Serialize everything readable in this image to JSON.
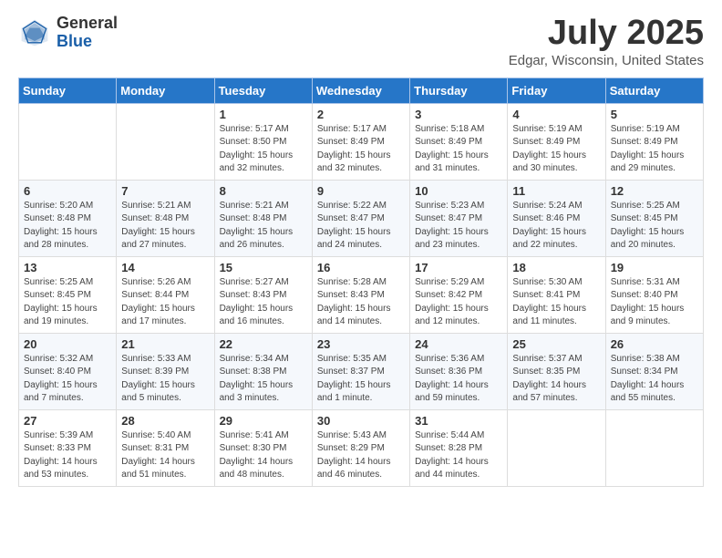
{
  "header": {
    "logo_general": "General",
    "logo_blue": "Blue",
    "month_title": "July 2025",
    "location": "Edgar, Wisconsin, United States"
  },
  "weekdays": [
    "Sunday",
    "Monday",
    "Tuesday",
    "Wednesday",
    "Thursday",
    "Friday",
    "Saturday"
  ],
  "weeks": [
    [
      {
        "day": "",
        "info": ""
      },
      {
        "day": "",
        "info": ""
      },
      {
        "day": "1",
        "info": "Sunrise: 5:17 AM\nSunset: 8:50 PM\nDaylight: 15 hours and 32 minutes."
      },
      {
        "day": "2",
        "info": "Sunrise: 5:17 AM\nSunset: 8:49 PM\nDaylight: 15 hours and 32 minutes."
      },
      {
        "day": "3",
        "info": "Sunrise: 5:18 AM\nSunset: 8:49 PM\nDaylight: 15 hours and 31 minutes."
      },
      {
        "day": "4",
        "info": "Sunrise: 5:19 AM\nSunset: 8:49 PM\nDaylight: 15 hours and 30 minutes."
      },
      {
        "day": "5",
        "info": "Sunrise: 5:19 AM\nSunset: 8:49 PM\nDaylight: 15 hours and 29 minutes."
      }
    ],
    [
      {
        "day": "6",
        "info": "Sunrise: 5:20 AM\nSunset: 8:48 PM\nDaylight: 15 hours and 28 minutes."
      },
      {
        "day": "7",
        "info": "Sunrise: 5:21 AM\nSunset: 8:48 PM\nDaylight: 15 hours and 27 minutes."
      },
      {
        "day": "8",
        "info": "Sunrise: 5:21 AM\nSunset: 8:48 PM\nDaylight: 15 hours and 26 minutes."
      },
      {
        "day": "9",
        "info": "Sunrise: 5:22 AM\nSunset: 8:47 PM\nDaylight: 15 hours and 24 minutes."
      },
      {
        "day": "10",
        "info": "Sunrise: 5:23 AM\nSunset: 8:47 PM\nDaylight: 15 hours and 23 minutes."
      },
      {
        "day": "11",
        "info": "Sunrise: 5:24 AM\nSunset: 8:46 PM\nDaylight: 15 hours and 22 minutes."
      },
      {
        "day": "12",
        "info": "Sunrise: 5:25 AM\nSunset: 8:45 PM\nDaylight: 15 hours and 20 minutes."
      }
    ],
    [
      {
        "day": "13",
        "info": "Sunrise: 5:25 AM\nSunset: 8:45 PM\nDaylight: 15 hours and 19 minutes."
      },
      {
        "day": "14",
        "info": "Sunrise: 5:26 AM\nSunset: 8:44 PM\nDaylight: 15 hours and 17 minutes."
      },
      {
        "day": "15",
        "info": "Sunrise: 5:27 AM\nSunset: 8:43 PM\nDaylight: 15 hours and 16 minutes."
      },
      {
        "day": "16",
        "info": "Sunrise: 5:28 AM\nSunset: 8:43 PM\nDaylight: 15 hours and 14 minutes."
      },
      {
        "day": "17",
        "info": "Sunrise: 5:29 AM\nSunset: 8:42 PM\nDaylight: 15 hours and 12 minutes."
      },
      {
        "day": "18",
        "info": "Sunrise: 5:30 AM\nSunset: 8:41 PM\nDaylight: 15 hours and 11 minutes."
      },
      {
        "day": "19",
        "info": "Sunrise: 5:31 AM\nSunset: 8:40 PM\nDaylight: 15 hours and 9 minutes."
      }
    ],
    [
      {
        "day": "20",
        "info": "Sunrise: 5:32 AM\nSunset: 8:40 PM\nDaylight: 15 hours and 7 minutes."
      },
      {
        "day": "21",
        "info": "Sunrise: 5:33 AM\nSunset: 8:39 PM\nDaylight: 15 hours and 5 minutes."
      },
      {
        "day": "22",
        "info": "Sunrise: 5:34 AM\nSunset: 8:38 PM\nDaylight: 15 hours and 3 minutes."
      },
      {
        "day": "23",
        "info": "Sunrise: 5:35 AM\nSunset: 8:37 PM\nDaylight: 15 hours and 1 minute."
      },
      {
        "day": "24",
        "info": "Sunrise: 5:36 AM\nSunset: 8:36 PM\nDaylight: 14 hours and 59 minutes."
      },
      {
        "day": "25",
        "info": "Sunrise: 5:37 AM\nSunset: 8:35 PM\nDaylight: 14 hours and 57 minutes."
      },
      {
        "day": "26",
        "info": "Sunrise: 5:38 AM\nSunset: 8:34 PM\nDaylight: 14 hours and 55 minutes."
      }
    ],
    [
      {
        "day": "27",
        "info": "Sunrise: 5:39 AM\nSunset: 8:33 PM\nDaylight: 14 hours and 53 minutes."
      },
      {
        "day": "28",
        "info": "Sunrise: 5:40 AM\nSunset: 8:31 PM\nDaylight: 14 hours and 51 minutes."
      },
      {
        "day": "29",
        "info": "Sunrise: 5:41 AM\nSunset: 8:30 PM\nDaylight: 14 hours and 48 minutes."
      },
      {
        "day": "30",
        "info": "Sunrise: 5:43 AM\nSunset: 8:29 PM\nDaylight: 14 hours and 46 minutes."
      },
      {
        "day": "31",
        "info": "Sunrise: 5:44 AM\nSunset: 8:28 PM\nDaylight: 14 hours and 44 minutes."
      },
      {
        "day": "",
        "info": ""
      },
      {
        "day": "",
        "info": ""
      }
    ]
  ]
}
